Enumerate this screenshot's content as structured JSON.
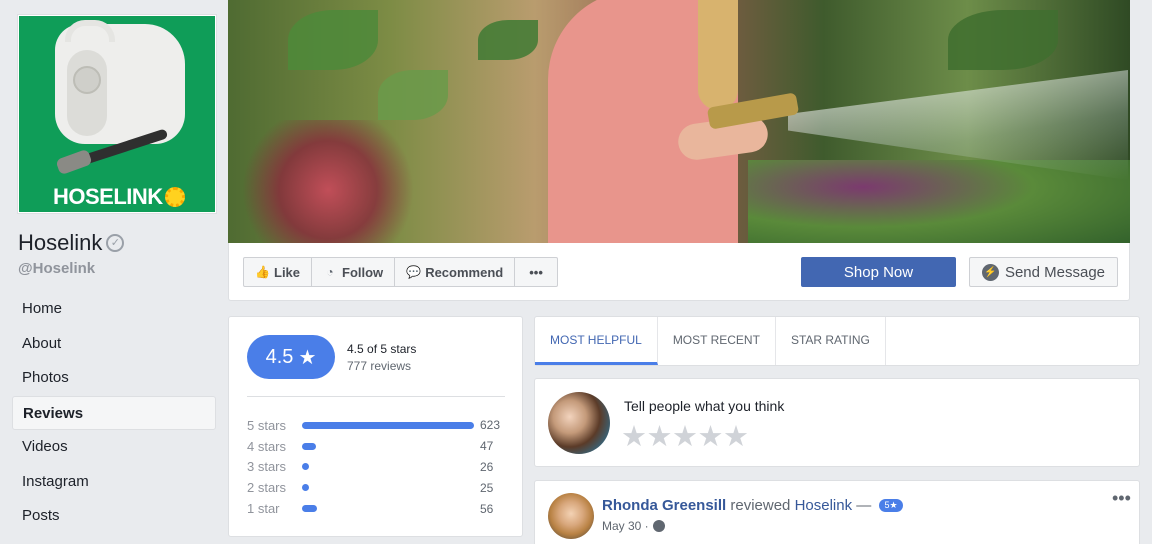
{
  "page": {
    "logo_text": "HOSELINK",
    "name": "Hoselink",
    "verified_icon": "verified-check-icon",
    "handle": "@Hoselink"
  },
  "sidebar": {
    "items": [
      {
        "label": "Home",
        "active": false
      },
      {
        "label": "About",
        "active": false
      },
      {
        "label": "Photos",
        "active": false
      },
      {
        "label": "Reviews",
        "active": true
      },
      {
        "label": "Videos",
        "active": false
      },
      {
        "label": "Instagram",
        "active": false
      },
      {
        "label": "Posts",
        "active": false
      }
    ]
  },
  "actions": {
    "like": "Like",
    "follow": "Follow",
    "recommend": "Recommend",
    "more": "•••",
    "shop_now": "Shop Now",
    "send_message": "Send Message"
  },
  "rating": {
    "score": "4.5",
    "star": "★",
    "summary": "4.5 of 5 stars",
    "reviews": "777 reviews",
    "distribution": [
      {
        "label": "5 stars",
        "count": 623,
        "fraction": 1.0
      },
      {
        "label": "4 stars",
        "count": 47,
        "fraction": 0.08
      },
      {
        "label": "3 stars",
        "count": 26,
        "fraction": 0.04
      },
      {
        "label": "2 stars",
        "count": 25,
        "fraction": 0.04
      },
      {
        "label": "1 star",
        "count": 56,
        "fraction": 0.09
      }
    ]
  },
  "tabs": [
    {
      "label": "MOST HELPFUL",
      "active": true
    },
    {
      "label": "MOST RECENT",
      "active": false
    },
    {
      "label": "STAR RATING",
      "active": false
    }
  ],
  "compose": {
    "prompt": "Tell people what you think",
    "stars": [
      "★",
      "★",
      "★",
      "★",
      "★"
    ]
  },
  "review": {
    "author": "Rhonda Greensill",
    "verb": "reviewed",
    "page": "Hoselink",
    "dash": "—",
    "badge": "5★",
    "date": "May 30 ·",
    "more": "•••"
  },
  "colors": {
    "accent": "#4267b2",
    "rating_blue": "#4a7ee8",
    "link": "#365899",
    "background": "#e9ebee"
  }
}
